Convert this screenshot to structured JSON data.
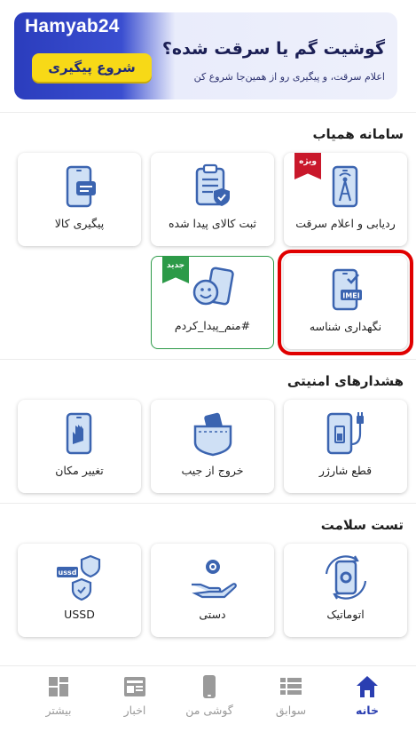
{
  "banner": {
    "brand": "Hamyab24",
    "cta": "شروع پیگیری",
    "headline": "گوشیت گم یا سرقت شده؟",
    "sub": "اعلام سرقت، و پیگیری رو از همین‌جا شروع کن"
  },
  "sections": {
    "hamyab": "سامانه همیاب",
    "alerts": "هشدارهای امنیتی",
    "health": "تست سلامت"
  },
  "hamyab_cards": {
    "track": "ردیابی و اعلام سرقت",
    "register": "ثبت کالای پیدا شده",
    "follow": "پیگیری کالا",
    "imei": "نگهداری شناسه",
    "found": "#منم_پیدا_کردم"
  },
  "badges": {
    "special": "ویژه",
    "new": "جدید"
  },
  "alert_cards": {
    "charger": "قطع شارژر",
    "pocket": "خروج از جیب",
    "location": "تغییر مکان"
  },
  "health_cards": {
    "auto": "اتوماتیک",
    "manual": "دستی",
    "ussd": "USSD"
  },
  "icon_text": {
    "imei": "IMEI",
    "ussd": "ussd"
  },
  "nav": {
    "home": "خانه",
    "history": "سوابق",
    "myphone": "گوشی من",
    "news": "اخبار",
    "more": "بیشتر"
  },
  "colors": {
    "primary": "#2a3eb1",
    "icon_blue": "#3b64b0",
    "icon_light": "#cfe0f5",
    "highlight": "#e00000",
    "special_badge": "#c9182b",
    "new_badge": "#2c9a48",
    "cta_yellow": "#f7d917"
  }
}
